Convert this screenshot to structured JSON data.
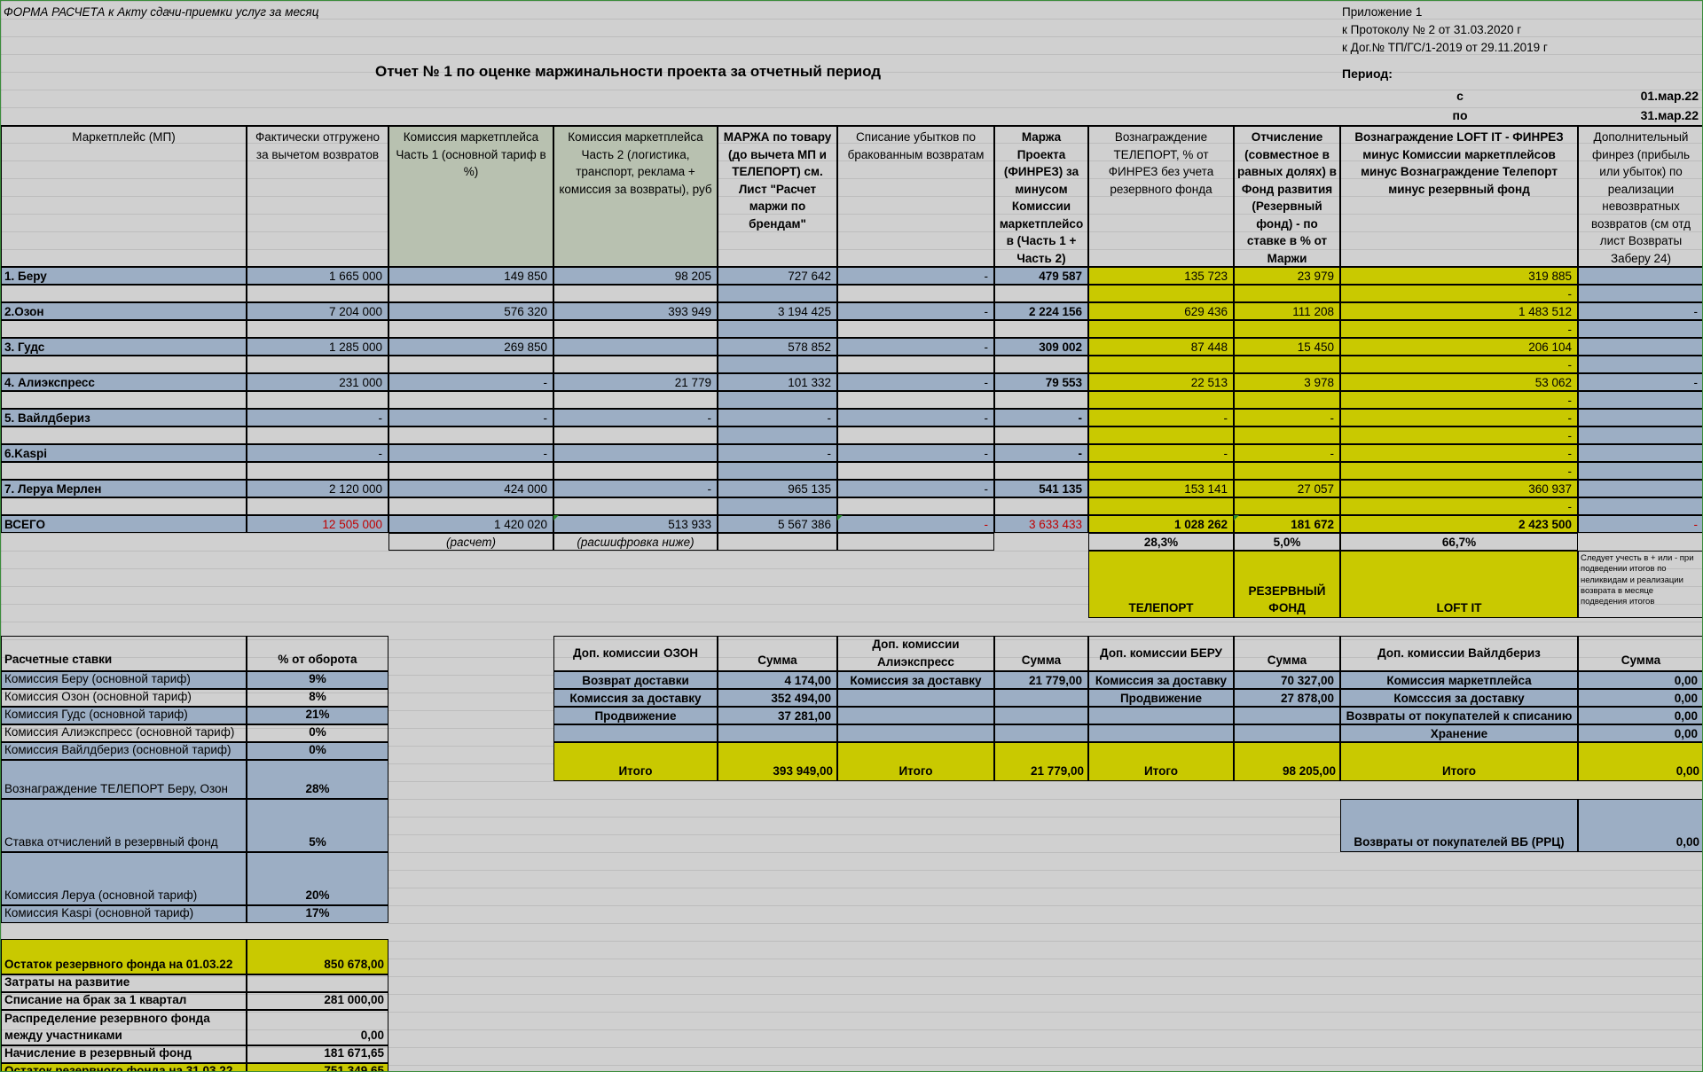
{
  "top": {
    "form_title": "ФОРМА РАСЧЕТА к Акту сдачи-приемки услуг за месяц",
    "appendix1": "Приложение 1",
    "appendix2": "к Протоколу № 2 от 31.03.2020 г",
    "appendix3": "к Дог.№ ТП/ГС/1-2019  от 29.11.2019 г",
    "report_title": "Отчет № 1  по оценке маржинальности проекта за отчетный период",
    "period_label": "Период:",
    "from_label": "с",
    "from_date": "01.мар.22",
    "to_label": "по",
    "to_date": "31.мар.22"
  },
  "headers": [
    "Маркетплейс (МП)",
    "Фактически отгружено за вычетом возвратов",
    "Комиссия маркетплейса Часть 1 (основной тариф в %)",
    "Комиссия маркетплейса Часть 2 (логистика, транспорт, реклама + комиссия за возвраты), руб",
    "МАРЖА по товару (до вычета МП и ТЕЛЕПОРТ) см. Лист \"Расчет маржи по брендам\"",
    "Списание убытков по бракованным возвратам",
    "Маржа Проекта (ФИНРЕЗ) за минусом Комиссии маркетплейсо в  (Часть 1 + Часть 2)",
    "Вознаграждение ТЕЛЕПОРТ, % от ФИНРЕЗ без учета резервного фонда",
    "Отчисление (совместное в равных долях)  в Фонд развития (Резервный фонд) - по ставке в  % от Маржи",
    "Вознаграждение LOFT IT - ФИНРЕЗ минус Комиссии маркетплейсов минус Вознаграждение Телепорт  минус резервный фонд",
    "Дополнительный финрез (прибыль или убыток) по реализации невозвратных возвратов (см отд лист Возвраты Заберу 24)"
  ],
  "rows": [
    {
      "name": "1. Беру",
      "shipped": "1 665 000",
      "comm1": "149 850",
      "comm2": "98 205",
      "margin": "727 642",
      "writeoff": "-",
      "finrez": "479 587",
      "teleport": "135 723",
      "reserve": "23 979",
      "loft": "319 885",
      "extra": "",
      "sub_loft": "-",
      "sub_extra": ""
    },
    {
      "name": "2.Озон",
      "shipped": "7 204 000",
      "comm1": "576 320",
      "comm2": "393 949",
      "margin": "3 194 425",
      "writeoff": "-",
      "finrez": "2 224 156",
      "teleport": "629 436",
      "reserve": "111 208",
      "loft": "1 483 512",
      "extra": "-",
      "sub_loft": "-",
      "sub_extra": ""
    },
    {
      "name": "3. Гудс",
      "shipped": "1 285 000",
      "comm1": "269 850",
      "comm2": "",
      "margin": "578 852",
      "writeoff": "-",
      "finrez": "309 002",
      "teleport": "87 448",
      "reserve": "15 450",
      "loft": "206 104",
      "extra": "",
      "sub_loft": "-",
      "sub_extra": ""
    },
    {
      "name": "4. Алиэкспресс",
      "shipped": "231 000",
      "comm1": "-",
      "comm2": "21 779",
      "margin": "101 332",
      "writeoff": "-",
      "finrez": "79 553",
      "teleport": "22 513",
      "reserve": "3 978",
      "loft": "53 062",
      "extra": "-",
      "sub_loft": "-",
      "sub_extra": ""
    },
    {
      "name": "5. Вайлдбериз",
      "shipped": "-",
      "comm1": "-",
      "comm2": "-",
      "margin": "-",
      "writeoff": "-",
      "finrez": "-",
      "teleport": "-",
      "reserve": "-",
      "loft": "-",
      "extra": "",
      "sub_loft": "-",
      "sub_extra": ""
    },
    {
      "name": "6.Kaspi",
      "shipped": "-",
      "comm1": "-",
      "comm2": "",
      "margin": "-",
      "writeoff": "-",
      "finrez": "-",
      "teleport": "-",
      "reserve": "-",
      "loft": "-",
      "extra": "",
      "sub_loft": "-",
      "sub_extra": ""
    },
    {
      "name": "7. Леруа Мерлен",
      "shipped": "2 120 000",
      "comm1": "424 000",
      "comm2": "-",
      "margin": "965 135",
      "writeoff": "-",
      "finrez": "541 135",
      "teleport": "153 141",
      "reserve": "27 057",
      "loft": "360 937",
      "extra": "",
      "sub_loft": "-",
      "sub_extra": ""
    }
  ],
  "total": {
    "name": "ВСЕГО",
    "shipped": "12 505 000",
    "comm1": "1 420 020",
    "comm2": "513 933",
    "margin": "5 567 386",
    "writeoff": "-",
    "finrez": "3 633 433",
    "teleport": "1 028 262",
    "reserve": "181 672",
    "loft": "2 423 500",
    "extra": "-"
  },
  "under_total": {
    "calc": "(расчет)",
    "decode": "(расшифровка ниже)",
    "pct_teleport": "28,3%",
    "pct_reserve": "5,0%",
    "pct_loft": "66,7%"
  },
  "legend": {
    "teleport": "ТЕЛЕПОРТ",
    "reserve": "РЕЗЕРВНЫЙ ФОНД",
    "loft": "LOFT IT",
    "note": "Следует учесть в + или - при подведении итогов по неликвидам и реализации возврата в месяце подведения итогов"
  },
  "rates": {
    "header_name": "Расчетные ставки",
    "header_pct": "% от оборота",
    "items": [
      {
        "name": "Комиссия Беру (основной тариф)",
        "value": "9%"
      },
      {
        "name": "Комиссия Озон (основной тариф)",
        "value": "8%"
      },
      {
        "name": "Комиссия Гудс (основной тариф)",
        "value": "21%"
      },
      {
        "name": "Комиссия Алиэкспресс (основной тариф)",
        "value": "0%"
      },
      {
        "name": "Комиссия Вайлдбериз (основной тариф)",
        "value": "0%"
      },
      {
        "name": "Вознаграждение ТЕЛЕПОРТ Беру, Озон",
        "value": "28%"
      },
      {
        "name": "Ставка отчислений в резервный фонд",
        "value": "5%"
      },
      {
        "name": "Комиссия Леруа (основной тариф)",
        "value": "20%"
      },
      {
        "name": "Комиссия Kaspi (основной тариф)",
        "value": "17%"
      }
    ]
  },
  "fund": {
    "items": [
      {
        "name": "Остаток резервного фонда на 01.03.22",
        "value": "850 678,00"
      },
      {
        "name": "Затраты на развитие",
        "value": ""
      },
      {
        "name": "Списание на брак за 1 квартал",
        "value": "281 000,00"
      },
      {
        "name": "Распределение резервного фонда между участниками",
        "value": "0,00"
      },
      {
        "name": "Начисление в резервный фонд",
        "value": "181 671,65"
      },
      {
        "name": "Остаток резервного фонда на 31.03.22",
        "value": "751 349,65"
      }
    ]
  },
  "ozon": {
    "title": "Доп. комиссии ОЗОН",
    "sum": "Сумма",
    "items": [
      {
        "name": "Возврат доставки",
        "value": "4 174,00"
      },
      {
        "name": "Комиссия за доставку",
        "value": "352 494,00"
      },
      {
        "name": "Продвижение",
        "value": "37 281,00"
      }
    ],
    "total_label": "Итого",
    "total": "393 949,00"
  },
  "ali": {
    "title": "Доп. комиссии Алиэкспресс",
    "sum": "Сумма",
    "items": [
      {
        "name": "Комиссия за доставку",
        "value": "21 779,00"
      }
    ],
    "total_label": "Итого",
    "total": "21 779,00"
  },
  "beru": {
    "title": "Доп. комиссии БЕРУ",
    "sum": "Сумма",
    "items": [
      {
        "name": "Комиссия за доставку",
        "value": "70 327,00"
      },
      {
        "name": "Продвижение",
        "value": "27 878,00"
      }
    ],
    "total_label": "Итого",
    "total": "98 205,00"
  },
  "wb": {
    "title": "Доп. комиссии Вайлдбериз",
    "sum": "Сумма",
    "items": [
      {
        "name": "Комиссия маркетплейса",
        "value": "0,00"
      },
      {
        "name": "Комсссия за доставку",
        "value": "0,00"
      },
      {
        "name": "Возвраты от покупателей к списанию",
        "value": "0,00"
      },
      {
        "name": "Хранение",
        "value": "0,00"
      }
    ],
    "total_label": "Итого",
    "total": "0,00",
    "returns_label": "Возвраты от покупателей ВБ (РРЦ)",
    "returns": "0,00"
  },
  "colors": {
    "blue": "#9caec4",
    "yellow": "#c9c900",
    "sage": "#b8c1b0",
    "grey": "#d0d0d0",
    "red": "#c00000"
  }
}
